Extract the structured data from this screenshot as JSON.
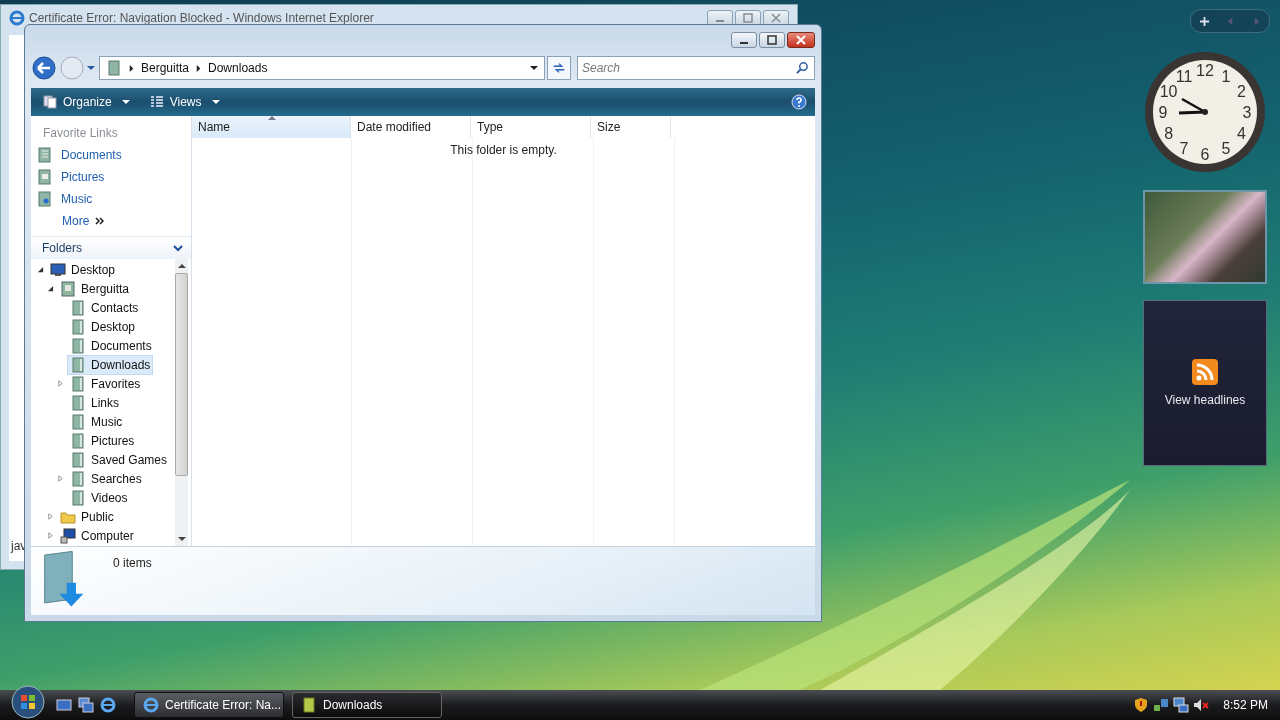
{
  "ie_window": {
    "title": "Certificate Error: Navigation Blocked - Windows Internet Explorer",
    "status_text": "jav"
  },
  "explorer": {
    "breadcrumb": [
      "Berguitta",
      "Downloads"
    ],
    "search": {
      "placeholder": "Search"
    },
    "toolbar": [
      {
        "label": "Organize"
      },
      {
        "label": "Views"
      }
    ],
    "favorite_links": {
      "title": "Favorite Links",
      "items": [
        {
          "label": "Documents",
          "kind": "documents"
        },
        {
          "label": "Pictures",
          "kind": "pictures"
        },
        {
          "label": "Music",
          "kind": "music"
        }
      ],
      "more": "More"
    },
    "folders": {
      "title": "Folders",
      "expanded": true,
      "tree": [
        {
          "label": "Desktop",
          "kind": "monitor",
          "expanded": true,
          "selected": false,
          "children": [
            {
              "label": "Berguitta",
              "kind": "user",
              "expanded": true,
              "selected": false,
              "children": [
                {
                  "label": "Contacts",
                  "kind": "library",
                  "selected": false
                },
                {
                  "label": "Desktop",
                  "kind": "library",
                  "selected": false
                },
                {
                  "label": "Documents",
                  "kind": "library",
                  "selected": false
                },
                {
                  "label": "Downloads",
                  "kind": "library",
                  "selected": true
                },
                {
                  "label": "Favorites",
                  "kind": "library",
                  "expanded": false,
                  "selected": false
                },
                {
                  "label": "Links",
                  "kind": "library",
                  "selected": false
                },
                {
                  "label": "Music",
                  "kind": "library",
                  "selected": false
                },
                {
                  "label": "Pictures",
                  "kind": "library",
                  "selected": false
                },
                {
                  "label": "Saved Games",
                  "kind": "library",
                  "selected": false
                },
                {
                  "label": "Searches",
                  "kind": "library",
                  "expanded": false,
                  "selected": false
                },
                {
                  "label": "Videos",
                  "kind": "library",
                  "selected": false
                }
              ]
            },
            {
              "label": "Public",
              "kind": "folder",
              "expanded": false,
              "selected": false
            },
            {
              "label": "Computer",
              "kind": "computer",
              "expanded": false,
              "selected": false
            }
          ]
        }
      ]
    },
    "columns": [
      {
        "label": "Name",
        "sorted": true
      },
      {
        "label": "Date modified",
        "sorted": false
      },
      {
        "label": "Type",
        "sorted": false
      },
      {
        "label": "Size",
        "sorted": false
      }
    ],
    "empty_message": "This folder is empty.",
    "details": {
      "count": "0 items"
    }
  },
  "taskbar": {
    "tasks": [
      {
        "label": "Certificate Error: Na...",
        "kind": "browser",
        "selected": false
      },
      {
        "label": "Downloads",
        "kind": "folder",
        "selected": true
      }
    ],
    "time": "8:52 PM"
  },
  "gadgets": {
    "clock": {
      "numerals": [
        "12",
        "11",
        "1",
        "10",
        "2",
        "9",
        "3",
        "8",
        "4",
        "7",
        "5",
        "6"
      ]
    },
    "feed": {
      "label": "View headlines"
    }
  }
}
